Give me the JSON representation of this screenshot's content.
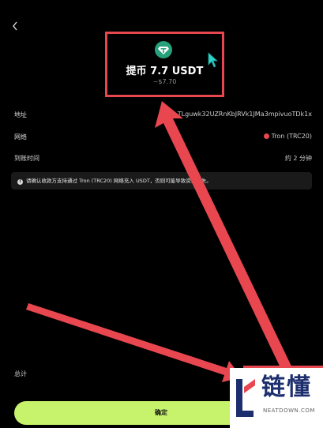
{
  "back_icon": "chevron-left-icon",
  "header": {
    "token_icon": "usdt-icon",
    "title": "提币 7.7 USDT",
    "subtitle": "~$7.70"
  },
  "rows": {
    "address": {
      "label": "地址",
      "value": "TLguwk32UZRnKbJRVk1JMa3mpivuoTDk1x"
    },
    "network": {
      "label": "网络",
      "value": "Tron (TRC20)",
      "icon": "tron-icon"
    },
    "arrival": {
      "label": "到账时间",
      "value": "约 2 分钟"
    }
  },
  "notice": {
    "icon": "info-icon",
    "text": "请确认收款方支持通过 Tron (TRC20) 网络充入 USDT，否则可能导致资金丢失。"
  },
  "total": {
    "label": "总计"
  },
  "confirm_button": "确定",
  "watermark": {
    "text": "链懂",
    "sub": "NEATDOWN.COM"
  },
  "colors": {
    "accent": "#c6f36b",
    "annotation": "#e8474f",
    "usdt": "#26a17b",
    "cursor": "#2fd3c8"
  }
}
